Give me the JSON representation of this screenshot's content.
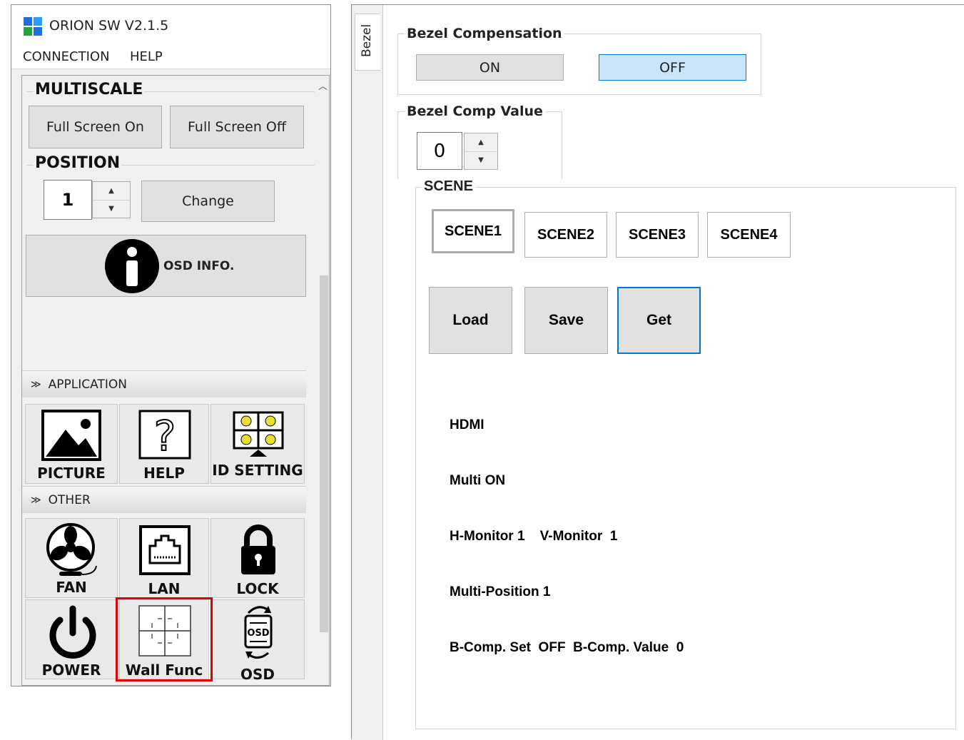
{
  "app": {
    "title": "ORION SW V2.1.5"
  },
  "menu": {
    "items": [
      "CONNECTION",
      "HELP"
    ]
  },
  "multiscale": {
    "heading": "MULTISCALE",
    "full_on": "Full Screen On",
    "full_off": "Full Screen Off"
  },
  "position": {
    "heading": "POSITION",
    "value": "1",
    "change": "Change"
  },
  "osd_info": {
    "label": "OSD INFO."
  },
  "application": {
    "heading": "APPLICATION",
    "tiles": [
      {
        "label": "PICTURE",
        "icon": "picture-icon"
      },
      {
        "label": "HELP",
        "icon": "help-icon"
      },
      {
        "label": "ID SETTING",
        "icon": "id-setting-icon"
      }
    ]
  },
  "other": {
    "heading": "OTHER",
    "tiles": [
      {
        "label": "FAN",
        "icon": "fan-icon"
      },
      {
        "label": "LAN",
        "icon": "lan-icon"
      },
      {
        "label": "LOCK",
        "icon": "lock-icon"
      },
      {
        "label": "POWER",
        "icon": "power-icon"
      },
      {
        "label": "Wall Func",
        "icon": "wall-func-icon"
      },
      {
        "label": "OSD",
        "icon": "osd-icon"
      }
    ],
    "highlighted": "Wall Func",
    "highlight_color": "#e00000"
  },
  "tab": {
    "label": "Bezel"
  },
  "bezel": {
    "group": "Bezel Compensation",
    "on": "ON",
    "off": "OFF",
    "selected": "OFF"
  },
  "bezel_value": {
    "group": "Bezel Comp Value",
    "value": "0"
  },
  "scene": {
    "group": "SCENE",
    "buttons": [
      "SCENE1",
      "SCENE2",
      "SCENE3",
      "SCENE4"
    ],
    "selected": "SCENE1",
    "load": "Load",
    "save": "Save",
    "get": "Get",
    "info": [
      "HDMI",
      "Multi ON",
      "H-Monitor 1    V-Monitor  1",
      "Multi-Position 1",
      "B-Comp. Set  OFF  B-Comp. Value  0"
    ]
  },
  "colors": {
    "accent": "#0078d7",
    "selected_fill": "#cce4f7"
  }
}
